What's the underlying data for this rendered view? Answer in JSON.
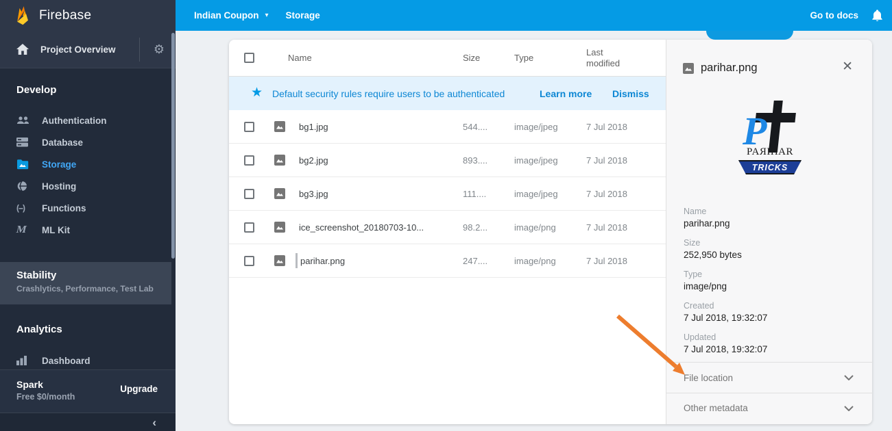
{
  "brand": {
    "name": "Firebase"
  },
  "topbar": {
    "project": "Indian Coupon",
    "page": "Storage",
    "docs_link": "Go to docs"
  },
  "sidebar": {
    "project_overview": "Project Overview",
    "develop": {
      "heading": "Develop",
      "items": [
        {
          "label": "Authentication"
        },
        {
          "label": "Database"
        },
        {
          "label": "Storage",
          "active": true
        },
        {
          "label": "Hosting"
        },
        {
          "label": "Functions"
        },
        {
          "label": "ML Kit"
        }
      ]
    },
    "stability": {
      "heading": "Stability",
      "subtitle": "Crashlytics, Performance, Test Lab"
    },
    "analytics": {
      "heading": "Analytics",
      "items": [
        {
          "label": "Dashboard"
        }
      ]
    },
    "plan": {
      "name": "Spark",
      "detail": "Free $0/month",
      "upgrade": "Upgrade"
    }
  },
  "files": {
    "columns": {
      "name": "Name",
      "size": "Size",
      "type": "Type",
      "modified": "Last modified"
    },
    "banner": {
      "message": "Default security rules require users to be authenticated",
      "learn_more": "Learn more",
      "dismiss": "Dismiss"
    },
    "rows": [
      {
        "name": "bg1.jpg",
        "size": "544....",
        "type": "image/jpeg",
        "modified": "7 Jul 2018"
      },
      {
        "name": "bg2.jpg",
        "size": "893....",
        "type": "image/jpeg",
        "modified": "7 Jul 2018"
      },
      {
        "name": "bg3.jpg",
        "size": "111....",
        "type": "image/jpeg",
        "modified": "7 Jul 2018"
      },
      {
        "name": "ice_screenshot_20180703-10...",
        "size": "98.2...",
        "type": "image/png",
        "modified": "7 Jul 2018"
      },
      {
        "name": "parihar.png",
        "size": "247....",
        "type": "image/png",
        "modified": "7 Jul 2018"
      }
    ]
  },
  "details": {
    "title": "parihar.png",
    "logo": {
      "p": "P",
      "wordmark": "PAЯIHAR",
      "banner": "TRICKS"
    },
    "fields": [
      {
        "label": "Name",
        "value": "parihar.png"
      },
      {
        "label": "Size",
        "value": "252,950 bytes"
      },
      {
        "label": "Type",
        "value": "image/png"
      },
      {
        "label": "Created",
        "value": "7 Jul 2018, 19:32:07"
      },
      {
        "label": "Updated",
        "value": "7 Jul 2018, 19:32:07"
      }
    ],
    "sections": [
      {
        "label": "File location"
      },
      {
        "label": "Other metadata"
      }
    ]
  },
  "icons": {
    "gear": "⚙",
    "caret": "▾",
    "star": "★",
    "close": "✕",
    "collapse": "‹",
    "functions": "(--)",
    "mlkit": "M"
  },
  "colors": {
    "accent_blue": "#059be5",
    "sidebar_bg": "#222b3a",
    "banner_bg": "#e3f2fd",
    "banner_text": "#0d87d4",
    "arrow_orange": "#ed7d2e",
    "logo_blue": "#1e88e5",
    "logo_navy": "#1c3e97"
  }
}
